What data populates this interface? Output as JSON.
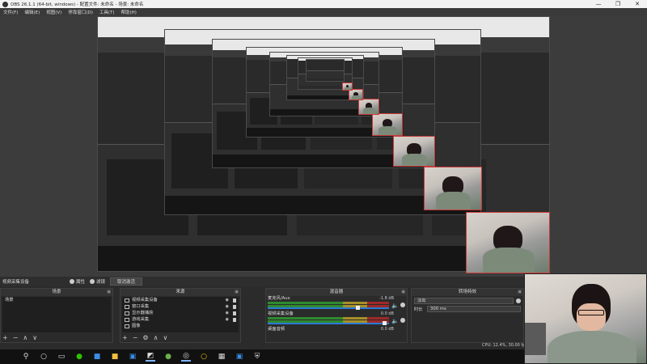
{
  "window": {
    "title": "OBS 26.1.1 (64-bit, windows) - 配置文件: 未命名 - 场景: 未命名",
    "minimize": "—",
    "maximize": "❐",
    "close": "✕"
  },
  "menu": [
    "文件(F)",
    "编辑(E)",
    "视图(V)",
    "停靠窗口(D)",
    "工具(T)",
    "帮助(H)"
  ],
  "toolbar": {
    "current_source": "视频采集设备",
    "properties": "属性",
    "filters": "滤镜",
    "deactivate": "取消激活"
  },
  "scenes": {
    "title": "场景",
    "items": [
      "场景"
    ],
    "foot": [
      "+",
      "−",
      "∧",
      "∨"
    ]
  },
  "sources": {
    "title": "来源",
    "items": [
      "视频采集设备",
      "窗口采集",
      "显示器捕获",
      "游戏采集",
      "图像"
    ],
    "foot": [
      "+",
      "−",
      "⚙",
      "∧",
      "∨"
    ]
  },
  "mixer": {
    "title": "混音器",
    "channels": [
      {
        "name": "麦克风/Aux",
        "db": "-1.8 dB",
        "level": 0.75
      },
      {
        "name": "视频采集设备",
        "db": "0.0 dB",
        "level": 0.98
      },
      {
        "name": "桌面音频",
        "db": "0.0 dB",
        "level": 0.98
      }
    ]
  },
  "transitions": {
    "title": "转场特效",
    "selected": "淡出",
    "duration_label": "时长",
    "duration_value": "300 ms"
  },
  "status": {
    "cpu": "CPU: 12.4%, 30.00 fps"
  },
  "taskbar": {
    "icons": [
      "windows-start",
      "search",
      "cortana",
      "task-view",
      "wechat",
      "mail",
      "explorer",
      "store",
      "steam",
      "chrome",
      "obs",
      "norton",
      "calculator",
      "photos",
      "shield"
    ]
  },
  "colors": {
    "accent": "#2b7ad6",
    "selection_border": "#c83a3a",
    "meter_green": "#2f8a2f",
    "meter_yellow": "#a69028",
    "meter_red": "#a02828"
  }
}
